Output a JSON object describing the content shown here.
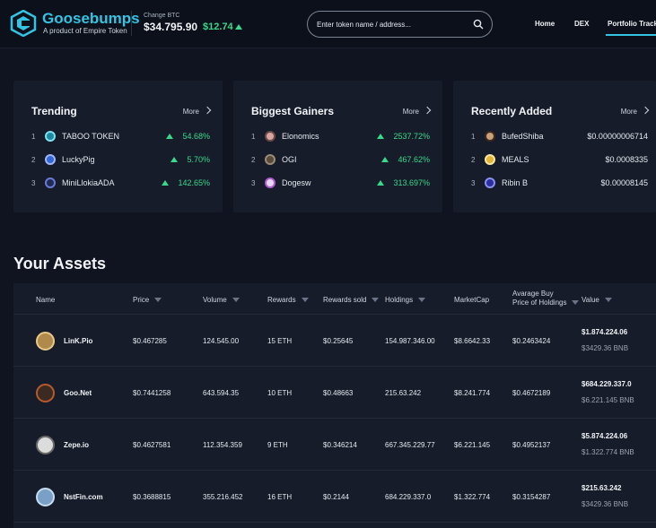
{
  "header": {
    "brand": "Goosebumps",
    "tagline": "A product of Empire Token",
    "btc_label": "Change BTC",
    "btc_price": "$34.795.90",
    "btc_change": "$12.74",
    "search_placeholder": "Enter token name / address...",
    "nav": [
      "Home",
      "DEX",
      "Portfolio Track"
    ],
    "colors": {
      "accent": "#34c4e3",
      "positive": "#39d98a",
      "background": "#0f1420",
      "card": "#161c2a"
    }
  },
  "trending": {
    "title": "Trending",
    "more": "More",
    "items": [
      {
        "idx": "1",
        "name": "TABOO TOKEN",
        "change": "54.68%",
        "icon": "taboo-coin-icon"
      },
      {
        "idx": "2",
        "name": "LuckyPig",
        "change": "5.70%",
        "icon": "luckypig-coin-icon"
      },
      {
        "idx": "3",
        "name": "MiniLlokiaADA",
        "change": "142.65%",
        "icon": "minillokia-coin-icon"
      }
    ]
  },
  "gainers": {
    "title": "Biggest Gainers",
    "more": "More",
    "items": [
      {
        "idx": "1",
        "name": "Elonomics",
        "change": "2537.72%",
        "icon": "elonomics-coin-icon"
      },
      {
        "idx": "2",
        "name": "OGI",
        "change": "467.62%",
        "icon": "ogi-coin-icon"
      },
      {
        "idx": "3",
        "name": "Dogesw",
        "change": "313.697%",
        "icon": "dogesw-coin-icon"
      }
    ]
  },
  "recent": {
    "title": "Recently Added",
    "more": "More",
    "items": [
      {
        "idx": "1",
        "name": "BufedShiba",
        "price": "$0.00000006714",
        "icon": "bufedshiba-coin-icon"
      },
      {
        "idx": "2",
        "name": "MEALS",
        "price": "$0.0008335",
        "icon": "meals-coin-icon"
      },
      {
        "idx": "3",
        "name": "Ribin B",
        "price": "$0.00008145",
        "icon": "ribinb-coin-icon"
      }
    ]
  },
  "assets": {
    "title": "Your Assets",
    "columns": {
      "name": "Name",
      "price": "Price",
      "volume": "Volume",
      "rewards": "Rewards",
      "rewards_sold": "Rewards sold",
      "holdings": "Holdings",
      "marketcap": "MarketCap",
      "avg_buy_1": "Avarage Buy",
      "avg_buy_2": "Price of Holdings",
      "value": "Value"
    },
    "rows": [
      {
        "name": "LinK.Pio",
        "price": "$0.467285",
        "volume": "124.545.00",
        "rewards": "15 ETH",
        "rewards_sold": "$0.25645",
        "holdings": "154.987.346.00",
        "marketcap": "$8.6642.33",
        "avg_buy": "$0.2463424",
        "value_usd": "$1.874.224.06",
        "value_bnb": "$3429.36 BNB"
      },
      {
        "name": "Goo.Net",
        "price": "$0.7441258",
        "volume": "643.594.35",
        "rewards": "10 ETH",
        "rewards_sold": "$0.48663",
        "holdings": "215.63.242",
        "marketcap": "$8.241.774",
        "avg_buy": "$0.4672189",
        "value_usd": "$684.229.337.0",
        "value_bnb": "$6.221.145 BNB"
      },
      {
        "name": "Zepe.io",
        "price": "$0.4627581",
        "volume": "112.354.359",
        "rewards": "9 ETH",
        "rewards_sold": "$0.346214",
        "holdings": "667.345.229.77",
        "marketcap": "$6.221.145",
        "avg_buy": "$0.4952137",
        "value_usd": "$5.874.224.06",
        "value_bnb": "$1.322.774 BNB"
      },
      {
        "name": "NstFin.com",
        "price": "$0.3688815",
        "volume": "355.216.452",
        "rewards": "16 ETH",
        "rewards_sold": "$0.2144",
        "holdings": "684.229.337.0",
        "marketcap": "$1.322.774",
        "avg_buy": "$0.3154287",
        "value_usd": "$215.63.242",
        "value_bnb": "$3429.36 BNB"
      }
    ]
  }
}
